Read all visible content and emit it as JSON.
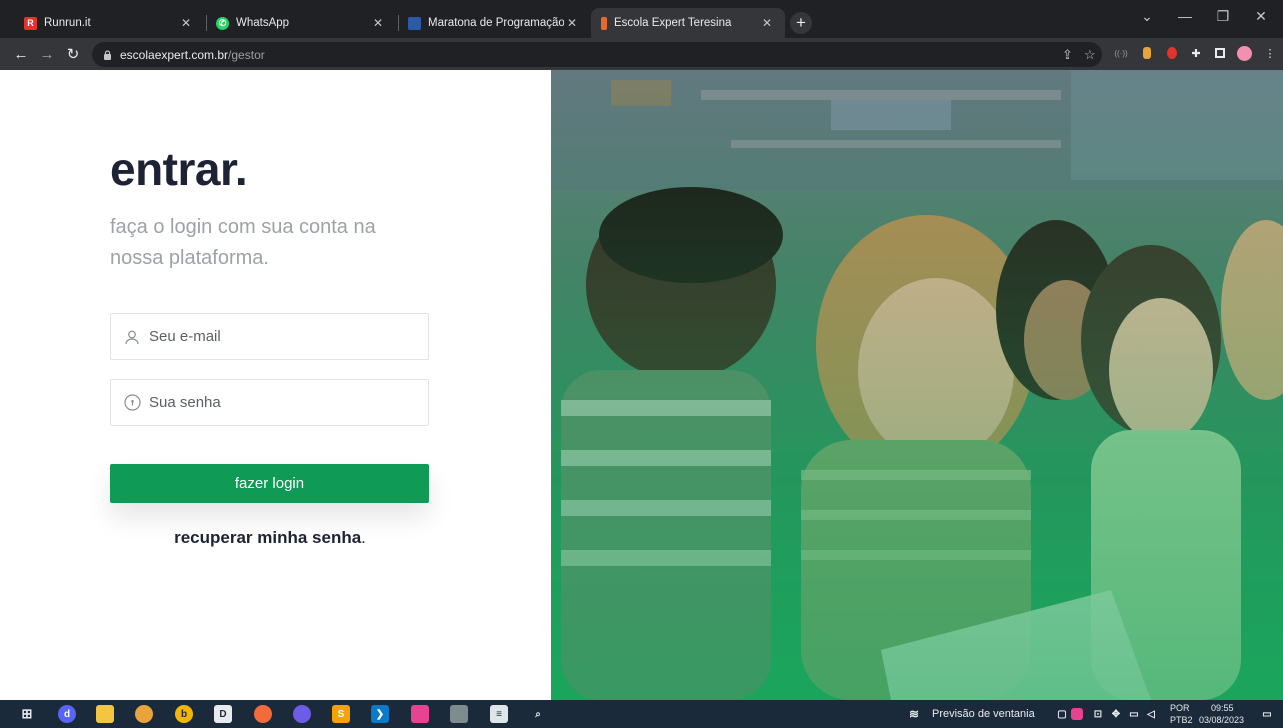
{
  "browser": {
    "tabs": [
      {
        "title": "Runrun.it",
        "favicon": "runrun-icon",
        "active": false
      },
      {
        "title": "WhatsApp",
        "favicon": "whatsapp-icon",
        "active": false
      },
      {
        "title": "Maratona de Programação SBC",
        "favicon": "maratona-icon",
        "active": false
      },
      {
        "title": "Escola Expert Teresina",
        "favicon": "escola-expert-icon",
        "active": true
      }
    ],
    "url_domain": "escolaexpert.com.br",
    "url_path": "/gestor"
  },
  "login": {
    "heading": "entrar.",
    "subtitle": "faça o login com sua conta na nossa plataforma.",
    "email_placeholder": "Seu e-mail",
    "password_placeholder": "Sua senha",
    "submit_label": "fazer login",
    "recover_label": "recuperar minha senha",
    "recover_suffix": "."
  },
  "hero": {
    "description_icon": "classroom-photo"
  },
  "taskbar": {
    "weather_text": "Previsão de ventania",
    "language": "POR",
    "keyboard": "PTB2",
    "time": "09:55",
    "date": "03/08/2023"
  },
  "colors": {
    "accent_green": "#0f9a55",
    "heading": "#1e2235",
    "subtitle": "#9ea1a8"
  }
}
